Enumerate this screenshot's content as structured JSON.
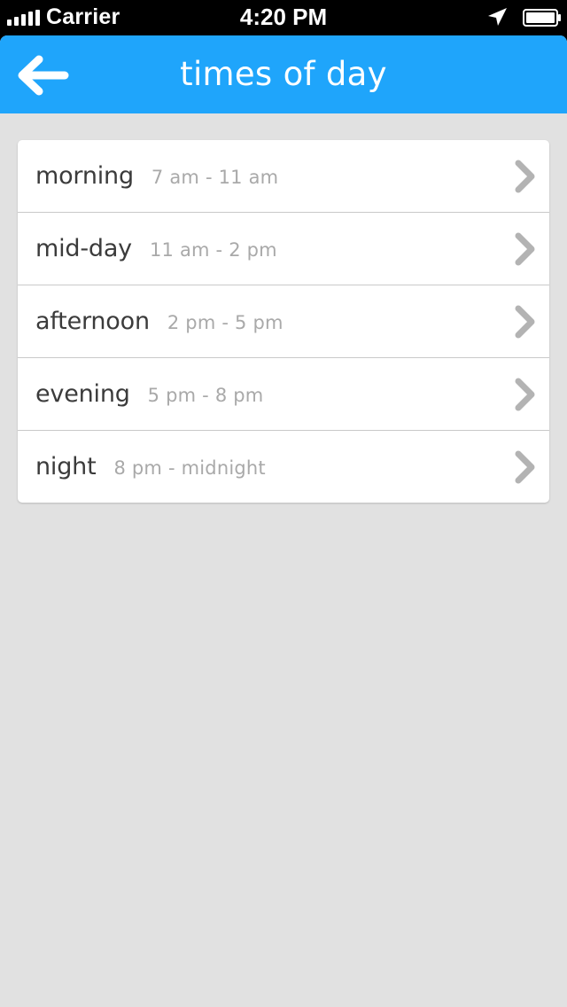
{
  "status_bar": {
    "carrier": "Carrier",
    "time": "4:20 PM"
  },
  "nav": {
    "title": "times of day",
    "back_icon": "arrow-left-icon"
  },
  "colors": {
    "nav_bg": "#1fa5fb",
    "page_bg": "#e1e1e1",
    "label_text": "#3b3b3b",
    "range_text": "#a9a9a9",
    "chevron": "#b3b3b3"
  },
  "times": [
    {
      "label": "morning",
      "range": "7 am - 11 am"
    },
    {
      "label": "mid-day",
      "range": "11 am - 2 pm"
    },
    {
      "label": "afternoon",
      "range": "2 pm - 5 pm"
    },
    {
      "label": "evening",
      "range": "5 pm - 8 pm"
    },
    {
      "label": "night",
      "range": "8 pm - midnight"
    }
  ]
}
